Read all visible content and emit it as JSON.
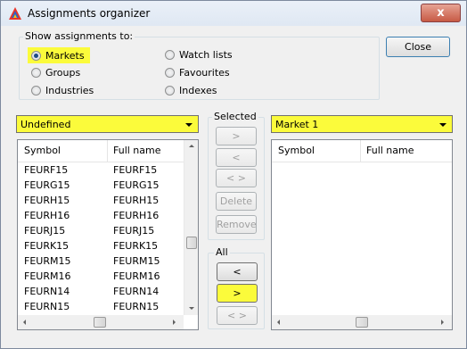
{
  "window": {
    "title": "Assignments organizer",
    "close_glyph": "x"
  },
  "show_group": {
    "legend": "Show assignments to:",
    "options": [
      {
        "label": "Markets",
        "checked": true
      },
      {
        "label": "Groups",
        "checked": false
      },
      {
        "label": "Industries",
        "checked": false
      },
      {
        "label": "Watch lists",
        "checked": false
      },
      {
        "label": "Favourites",
        "checked": false
      },
      {
        "label": "Indexes",
        "checked": false
      }
    ]
  },
  "close_button": "Close",
  "left_combo": {
    "value": "Undefined"
  },
  "right_combo": {
    "value": "Market 1"
  },
  "columns": {
    "symbol": "Symbol",
    "full_name": "Full name"
  },
  "left_rows": [
    {
      "symbol": "FEURF15",
      "full_name": "FEURF15"
    },
    {
      "symbol": "FEURG15",
      "full_name": "FEURG15"
    },
    {
      "symbol": "FEURH15",
      "full_name": "FEURH15"
    },
    {
      "symbol": "FEURH16",
      "full_name": "FEURH16"
    },
    {
      "symbol": "FEURJ15",
      "full_name": "FEURJ15"
    },
    {
      "symbol": "FEURK15",
      "full_name": "FEURK15"
    },
    {
      "symbol": "FEURM15",
      "full_name": "FEURM15"
    },
    {
      "symbol": "FEURM16",
      "full_name": "FEURM16"
    },
    {
      "symbol": "FEURN14",
      "full_name": "FEURN14"
    },
    {
      "symbol": "FEURN15",
      "full_name": "FEURN15"
    }
  ],
  "selected_group": {
    "legend": "Selected",
    "move_right": ">",
    "move_left": "<",
    "swap": "< >",
    "delete": "Delete",
    "remove": "Remove"
  },
  "all_group": {
    "legend": "All",
    "move_left": "<",
    "move_right": ">",
    "swap": "< >"
  },
  "highlight_color": "#fbfb3b"
}
